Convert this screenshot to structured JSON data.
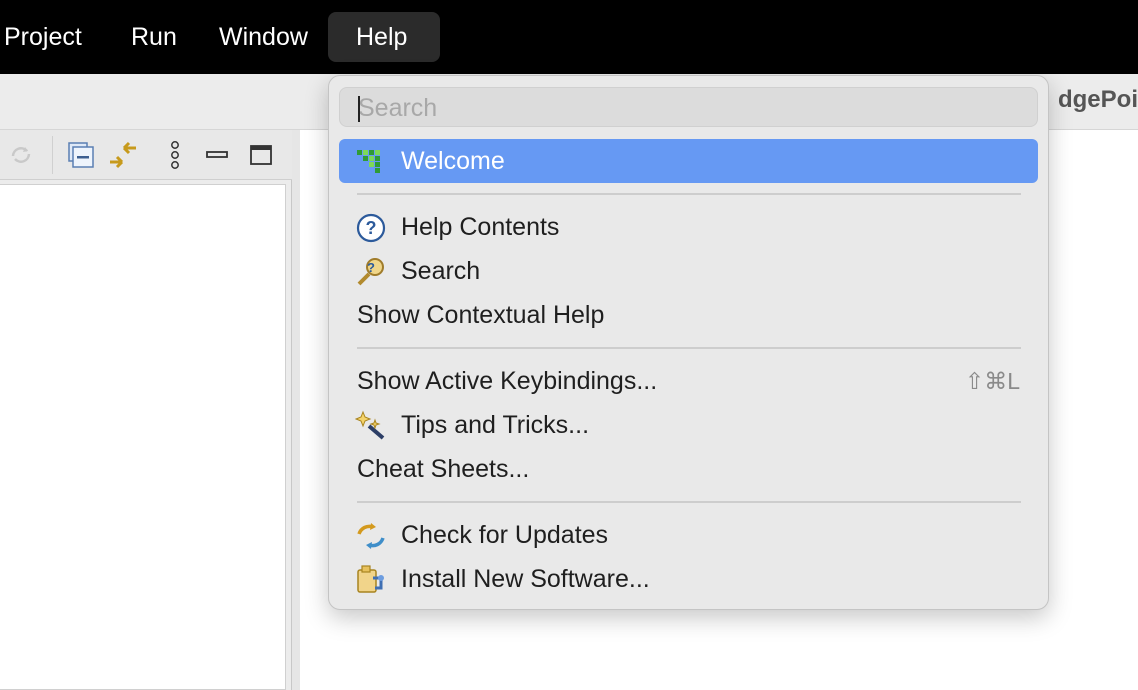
{
  "menubar": {
    "items": [
      {
        "label": "Project"
      },
      {
        "label": "Run"
      },
      {
        "label": "Window"
      },
      {
        "label": "Help"
      }
    ]
  },
  "editor": {
    "title_fragment": "dgePoi"
  },
  "view_toolbar": {
    "icons": [
      "sync-icon",
      "collapse-all-icon",
      "link-with-editor-icon",
      "view-menu-icon",
      "minimize-icon",
      "maximize-icon"
    ]
  },
  "help_menu": {
    "search": {
      "placeholder": "Search",
      "value": ""
    },
    "items": [
      {
        "label": "Welcome",
        "icon": "welcome-icon",
        "selected": true
      },
      {
        "label": "Help Contents",
        "icon": "help-contents-icon"
      },
      {
        "label": "Search",
        "icon": "help-search-icon"
      },
      {
        "label": "Show Contextual Help"
      },
      {
        "label": "Show Active Keybindings...",
        "shortcut": "⇧⌘L"
      },
      {
        "label": "Tips and Tricks...",
        "icon": "tips-icon"
      },
      {
        "label": "Cheat Sheets..."
      },
      {
        "label": "Check for Updates",
        "icon": "update-icon"
      },
      {
        "label": "Install New Software...",
        "icon": "install-icon"
      }
    ]
  },
  "colors": {
    "selection": "#6699f3",
    "menubar": "#000000"
  }
}
